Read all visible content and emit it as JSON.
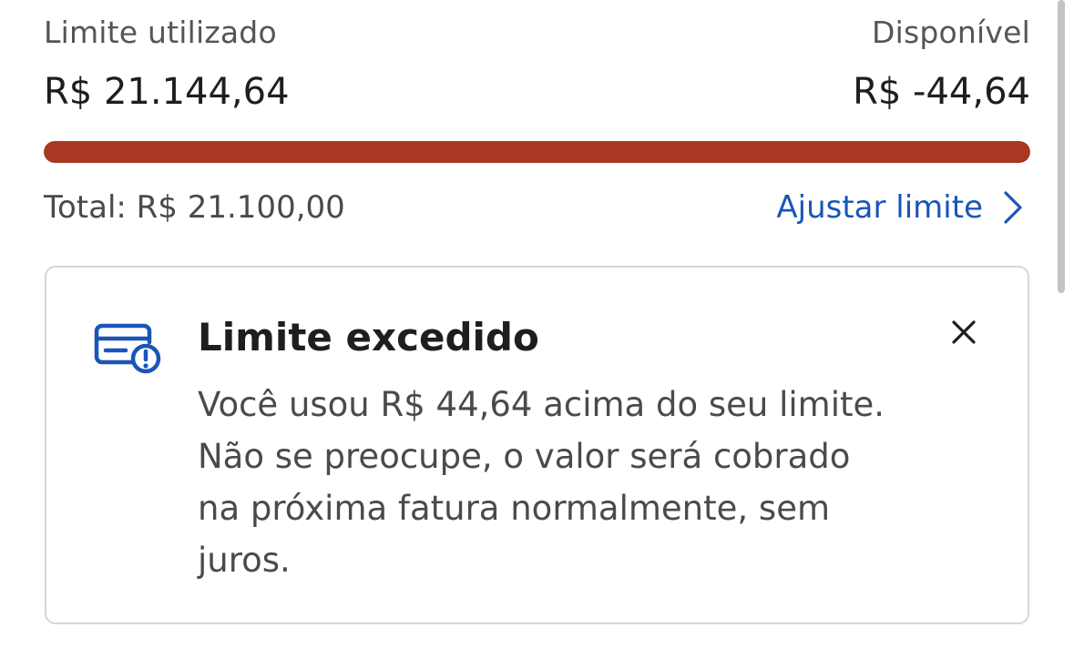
{
  "limit": {
    "used_label": "Limite utilizado",
    "used_value": "R$ 21.144,64",
    "available_label": "Disponível",
    "available_value": "R$ -44,64",
    "usage_fraction": 1.0,
    "bar_color": "#a83821",
    "total_text": "Total: R$ 21.100,00",
    "adjust_label": "Ajustar limite"
  },
  "alert": {
    "icon": "credit-card-alert-icon",
    "title": "Limite excedido",
    "lines": [
      "Você usou R$ 44,64 acima do seu limite.",
      "Não se preocupe, o valor será cobrado",
      "na próxima fatura normalmente, sem",
      "juros."
    ],
    "close_icon": "close-icon"
  },
  "colors": {
    "accent": "#1a55b8",
    "danger": "#a83821"
  }
}
